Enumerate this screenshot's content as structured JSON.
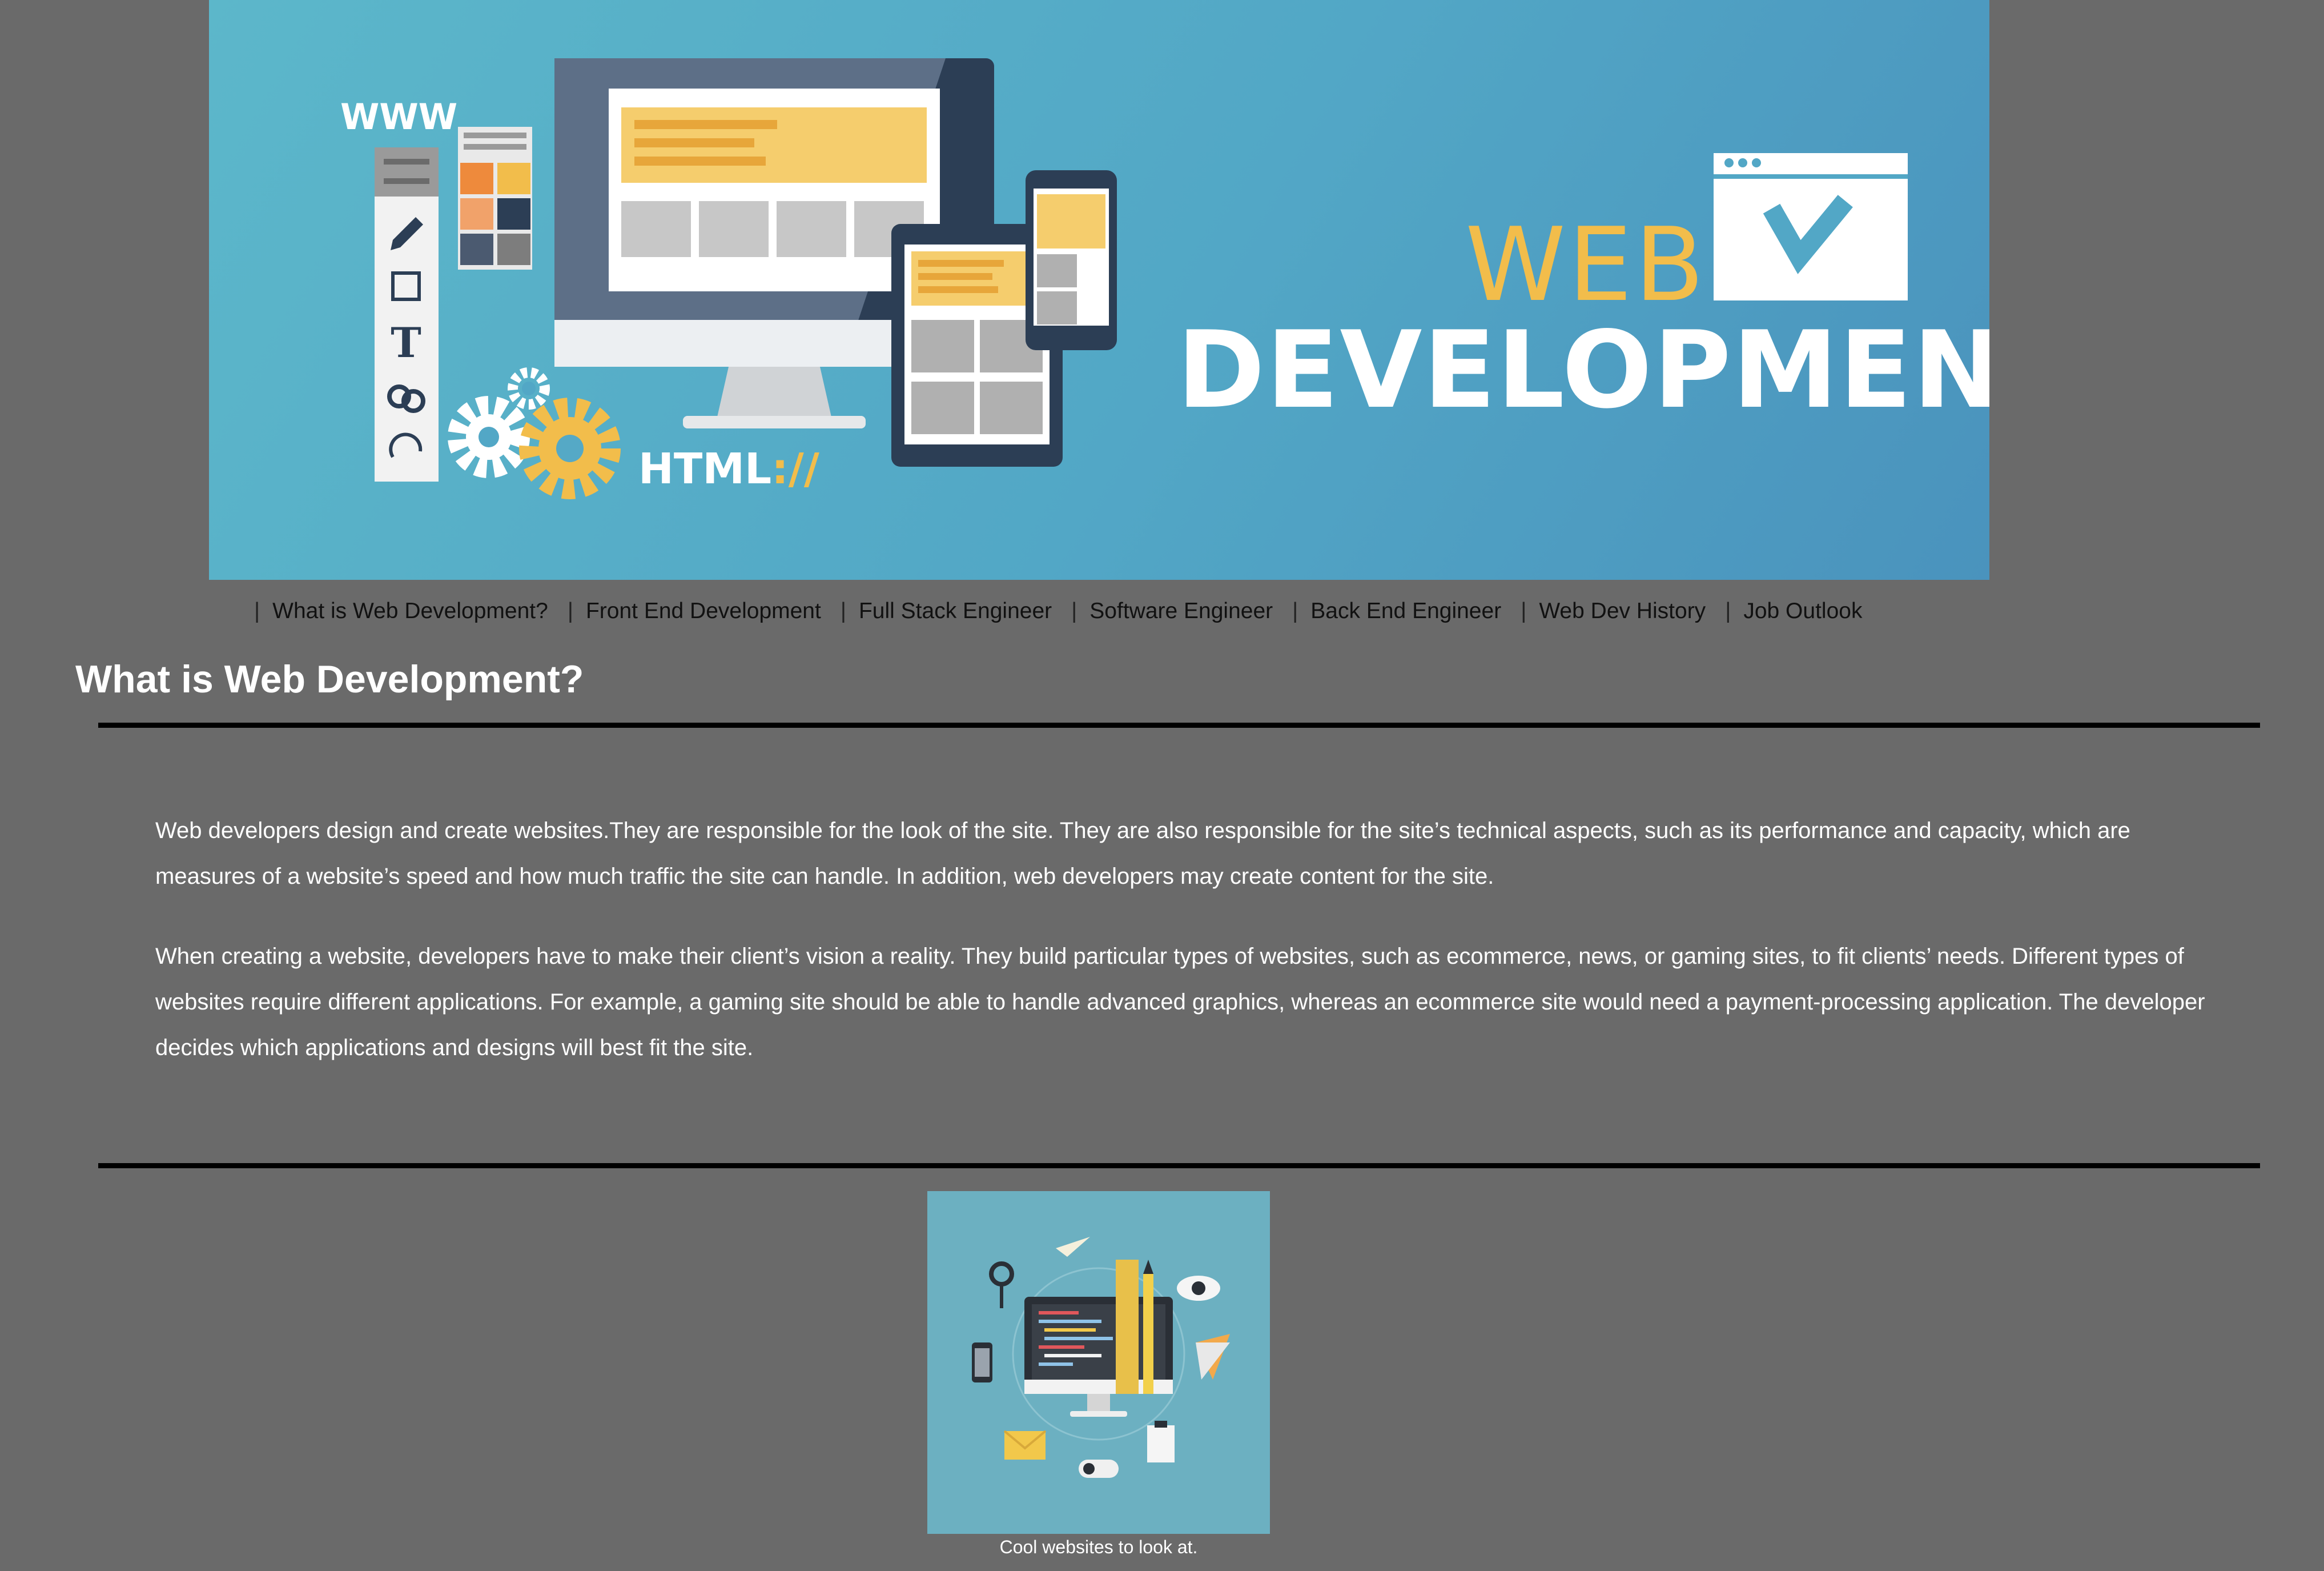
{
  "banner": {
    "web_word": "WEB",
    "development_word": "DEVELOPMENT",
    "www_label": "WWW",
    "html_label": "HTML",
    "html_accent": "://",
    "colors": {
      "background": "#52a7c6",
      "accent": "#f2bd4b",
      "dark": "#2c3e55"
    }
  },
  "nav": {
    "separator": "|",
    "items": [
      "What is Web Development?",
      "Front End Development",
      "Full Stack Engineer",
      "Software Engineer",
      "Back End Engineer",
      "Web Dev History",
      "Job Outlook"
    ]
  },
  "section": {
    "title": "What is Web Development?",
    "paragraphs": [
      "Web developers design and create websites.They are responsible for the look of the site. They are also responsible for the site’s technical aspects, such as its performance and capacity, which are measures of a website’s speed and how much traffic the site can handle. In addition, web developers may create content for the site.",
      "When creating a website, developers have to make their client’s vision a reality. They build particular types of websites, such as ecommerce, news, or gaming sites, to fit clients’ needs. Different types of websites require different applications. For example, a gaming site should be able to handle advanced graphics, whereas an ecommerce site would need a payment-processing application. The developer decides which applications and designs will best fit the site."
    ]
  },
  "figure": {
    "caption": "Cool websites to look at."
  },
  "page": {
    "background": "#6a6a6a"
  }
}
